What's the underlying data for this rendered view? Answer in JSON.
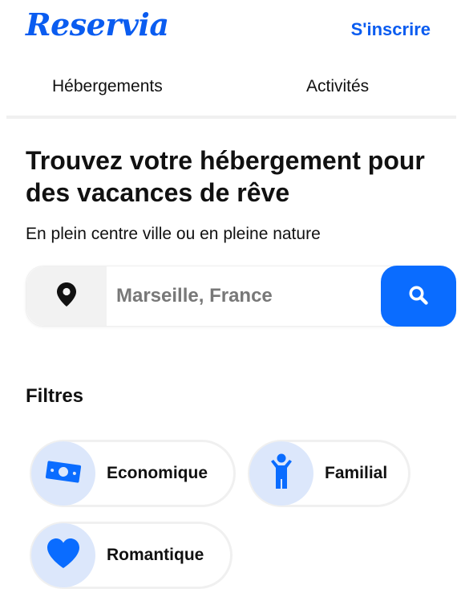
{
  "header": {
    "logo": "Reservia",
    "signup_label": "S'inscrire"
  },
  "tabs": [
    {
      "label": "Hébergements"
    },
    {
      "label": "Activités"
    }
  ],
  "hero": {
    "title": "Trouvez votre hébergement pour des vacances de rêve",
    "subtitle": "En plein centre ville ou en pleine nature"
  },
  "search": {
    "placeholder": "Marseille, France",
    "value": "",
    "pin_icon": "map-pin-icon",
    "button_icon": "search-icon"
  },
  "filters": {
    "title": "Filtres",
    "items": [
      {
        "label": "Economique",
        "icon": "money-bill-icon"
      },
      {
        "label": "Familial",
        "icon": "child-icon"
      },
      {
        "label": "Romantique",
        "icon": "heart-icon"
      }
    ]
  },
  "colors": {
    "brand": "#0a5cf0",
    "search_button": "#0a6cff",
    "chip_icon_bg": "#dce7fb"
  }
}
